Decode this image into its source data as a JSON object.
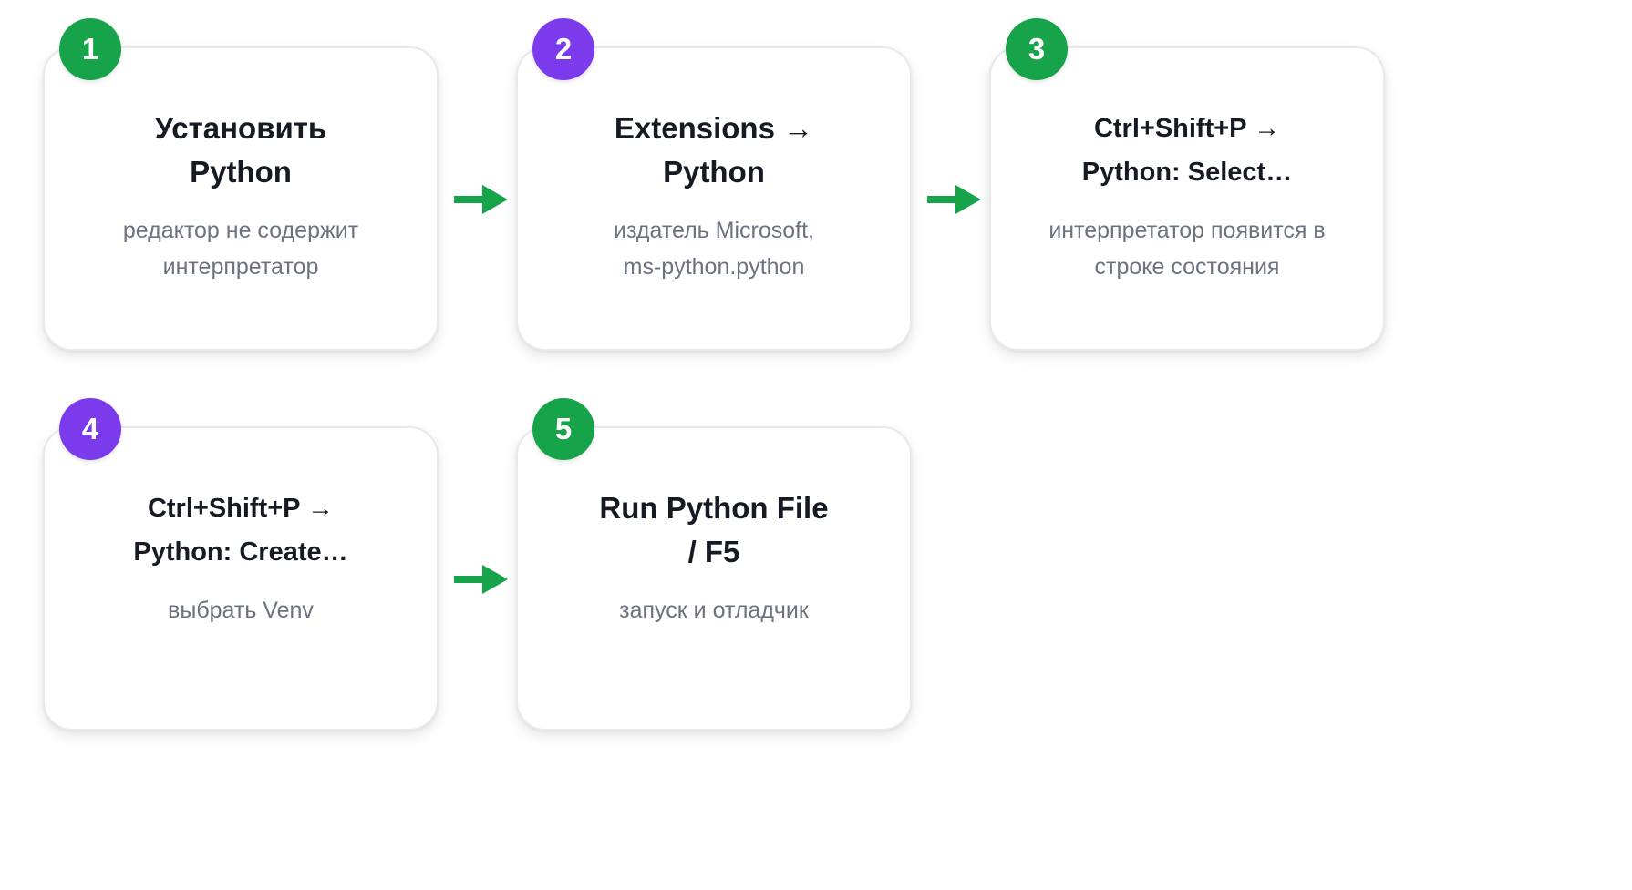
{
  "colors": {
    "green": "#16a34a",
    "purple": "#7c3aed",
    "arrow": "#16a34a"
  },
  "steps": [
    {
      "number": "1",
      "title": "Установить\nPython",
      "description": "редактор не содержит\nинтерпретатор",
      "badge_color": "green"
    },
    {
      "number": "2",
      "title": "Extensions →\nPython",
      "description": "издатель Microsoft,\nms-python.python",
      "badge_color": "purple"
    },
    {
      "number": "3",
      "title": "Ctrl+Shift+P →\nPython: Select…",
      "description": "интерпретатор появится в\nстроке состояния",
      "badge_color": "green"
    },
    {
      "number": "4",
      "title": "Ctrl+Shift+P →\nPython: Create…",
      "description": "выбрать Venv",
      "badge_color": "purple"
    },
    {
      "number": "5",
      "title": "Run Python File\n/ F5",
      "description": "запуск и отладчик",
      "badge_color": "green"
    }
  ],
  "arrows": [
    {
      "from": "1",
      "to": "2",
      "icon": "arrow-right-icon"
    },
    {
      "from": "2",
      "to": "3",
      "icon": "arrow-right-icon"
    },
    {
      "from": "4",
      "to": "5",
      "icon": "arrow-right-icon"
    }
  ]
}
